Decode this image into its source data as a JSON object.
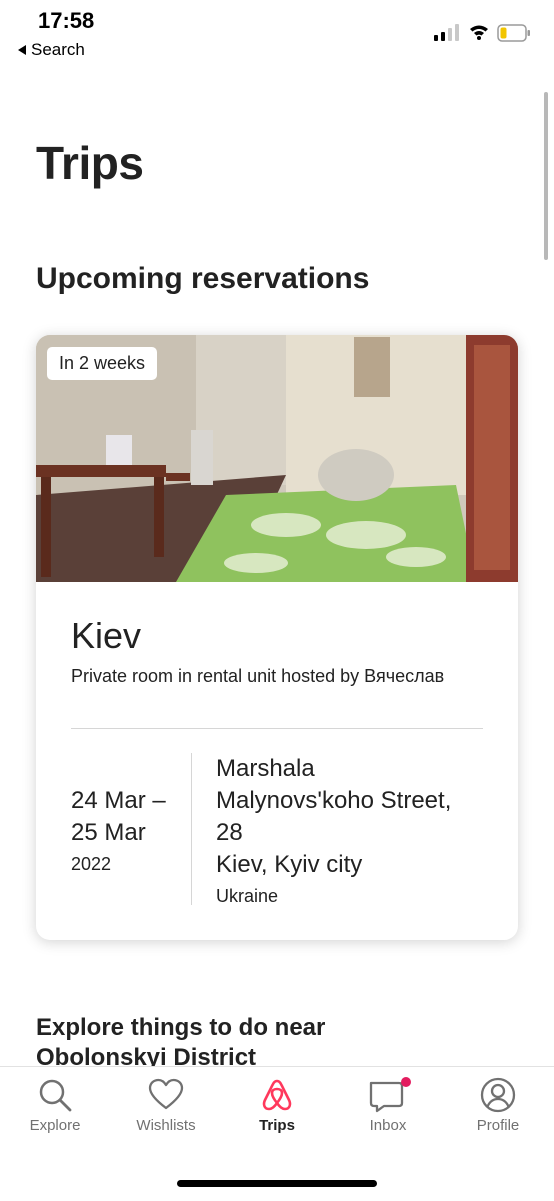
{
  "status_bar": {
    "time": "17:58",
    "back_label": "Search"
  },
  "page": {
    "title": "Trips",
    "section_title": "Upcoming reservations"
  },
  "reservation": {
    "badge": "In 2 weeks",
    "city": "Kiev",
    "description": "Private room in rental unit hosted by Вячеслав",
    "date_range_line1": "24 Mar –",
    "date_range_line2": "25 Mar",
    "year": "2022",
    "address_line1": "Marshala",
    "address_line2": "Malynovs'koho Street,",
    "address_line3": "28",
    "address_city": "Kiev, Kyiv city",
    "address_country": "Ukraine"
  },
  "explore": {
    "title_line1": "Explore things to do near",
    "title_line2": "Obolonskyi District"
  },
  "tab_bar": {
    "tabs": [
      {
        "label": "Explore",
        "icon": "search-icon"
      },
      {
        "label": "Wishlists",
        "icon": "heart-icon"
      },
      {
        "label": "Trips",
        "icon": "airbnb-logo-icon",
        "active": true
      },
      {
        "label": "Inbox",
        "icon": "chat-bubble-icon",
        "notification_dot": true
      },
      {
        "label": "Profile",
        "icon": "user-circle-icon"
      }
    ]
  },
  "colors": {
    "brand": "#FF385C",
    "text": "#222222",
    "muted": "#717171",
    "notification": "#E31C5F"
  }
}
